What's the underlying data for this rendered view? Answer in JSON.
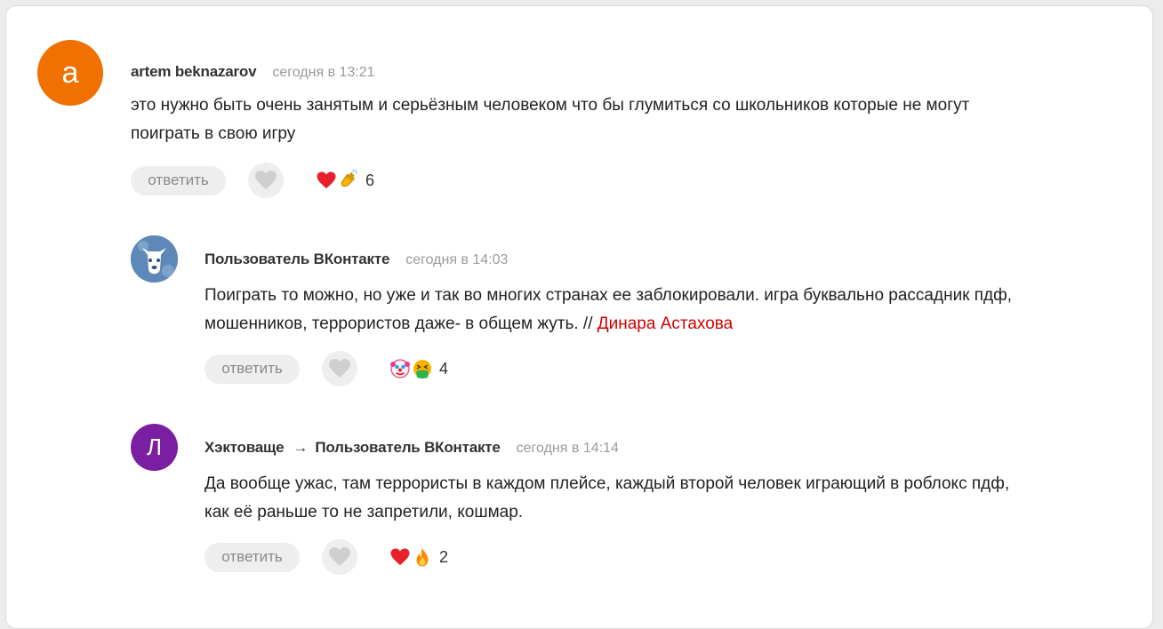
{
  "comments": [
    {
      "author": "artem beknazarov",
      "time": "сегодня в 13:21",
      "avatar_letter": "a",
      "avatar_color": "#f07000",
      "text_lines": [
        "это нужно быть очень занятым и серьёзным человеком что бы глумиться со школьников которые не могут",
        "поиграть в свою игру"
      ],
      "reply_label": "ответить",
      "reactions": [
        "heart-icon",
        "clap-icon"
      ],
      "reaction_count": "6"
    },
    {
      "author": "Пользователь ВКонтакте",
      "time": "сегодня в 14:03",
      "avatar_icon": "vk-dog-avatar",
      "text_lines": [
        "Поиграть то можно, но уже и так во многих странах ее заблокировали. игра буквально рассадник пдф,",
        "мошенников, террористов даже- в общем жуть. // "
      ],
      "mention": "Динара Астахова",
      "reply_label": "ответить",
      "reactions": [
        "clown-icon",
        "nauseated-face-icon"
      ],
      "reaction_count": "4"
    },
    {
      "author": "Хэктоваще",
      "reply_to": "Пользователь ВКонтакте",
      "arrow": "→",
      "time": "сегодня в 14:14",
      "avatar_letter": "Л",
      "avatar_color": "#7b1fa2",
      "text_lines": [
        "Да вообще ужас, там террористы в каждом плейсе, каждый второй человек играющий в роблокс пдф,",
        "как её раньше то не запретили, кошмар."
      ],
      "reply_label": "ответить",
      "reactions": [
        "heart-icon",
        "fire-icon"
      ],
      "reaction_count": "2"
    }
  ],
  "colors": {
    "link": "#d10000",
    "time": "#9a9a9a",
    "button_bg": "#eeeeee"
  }
}
